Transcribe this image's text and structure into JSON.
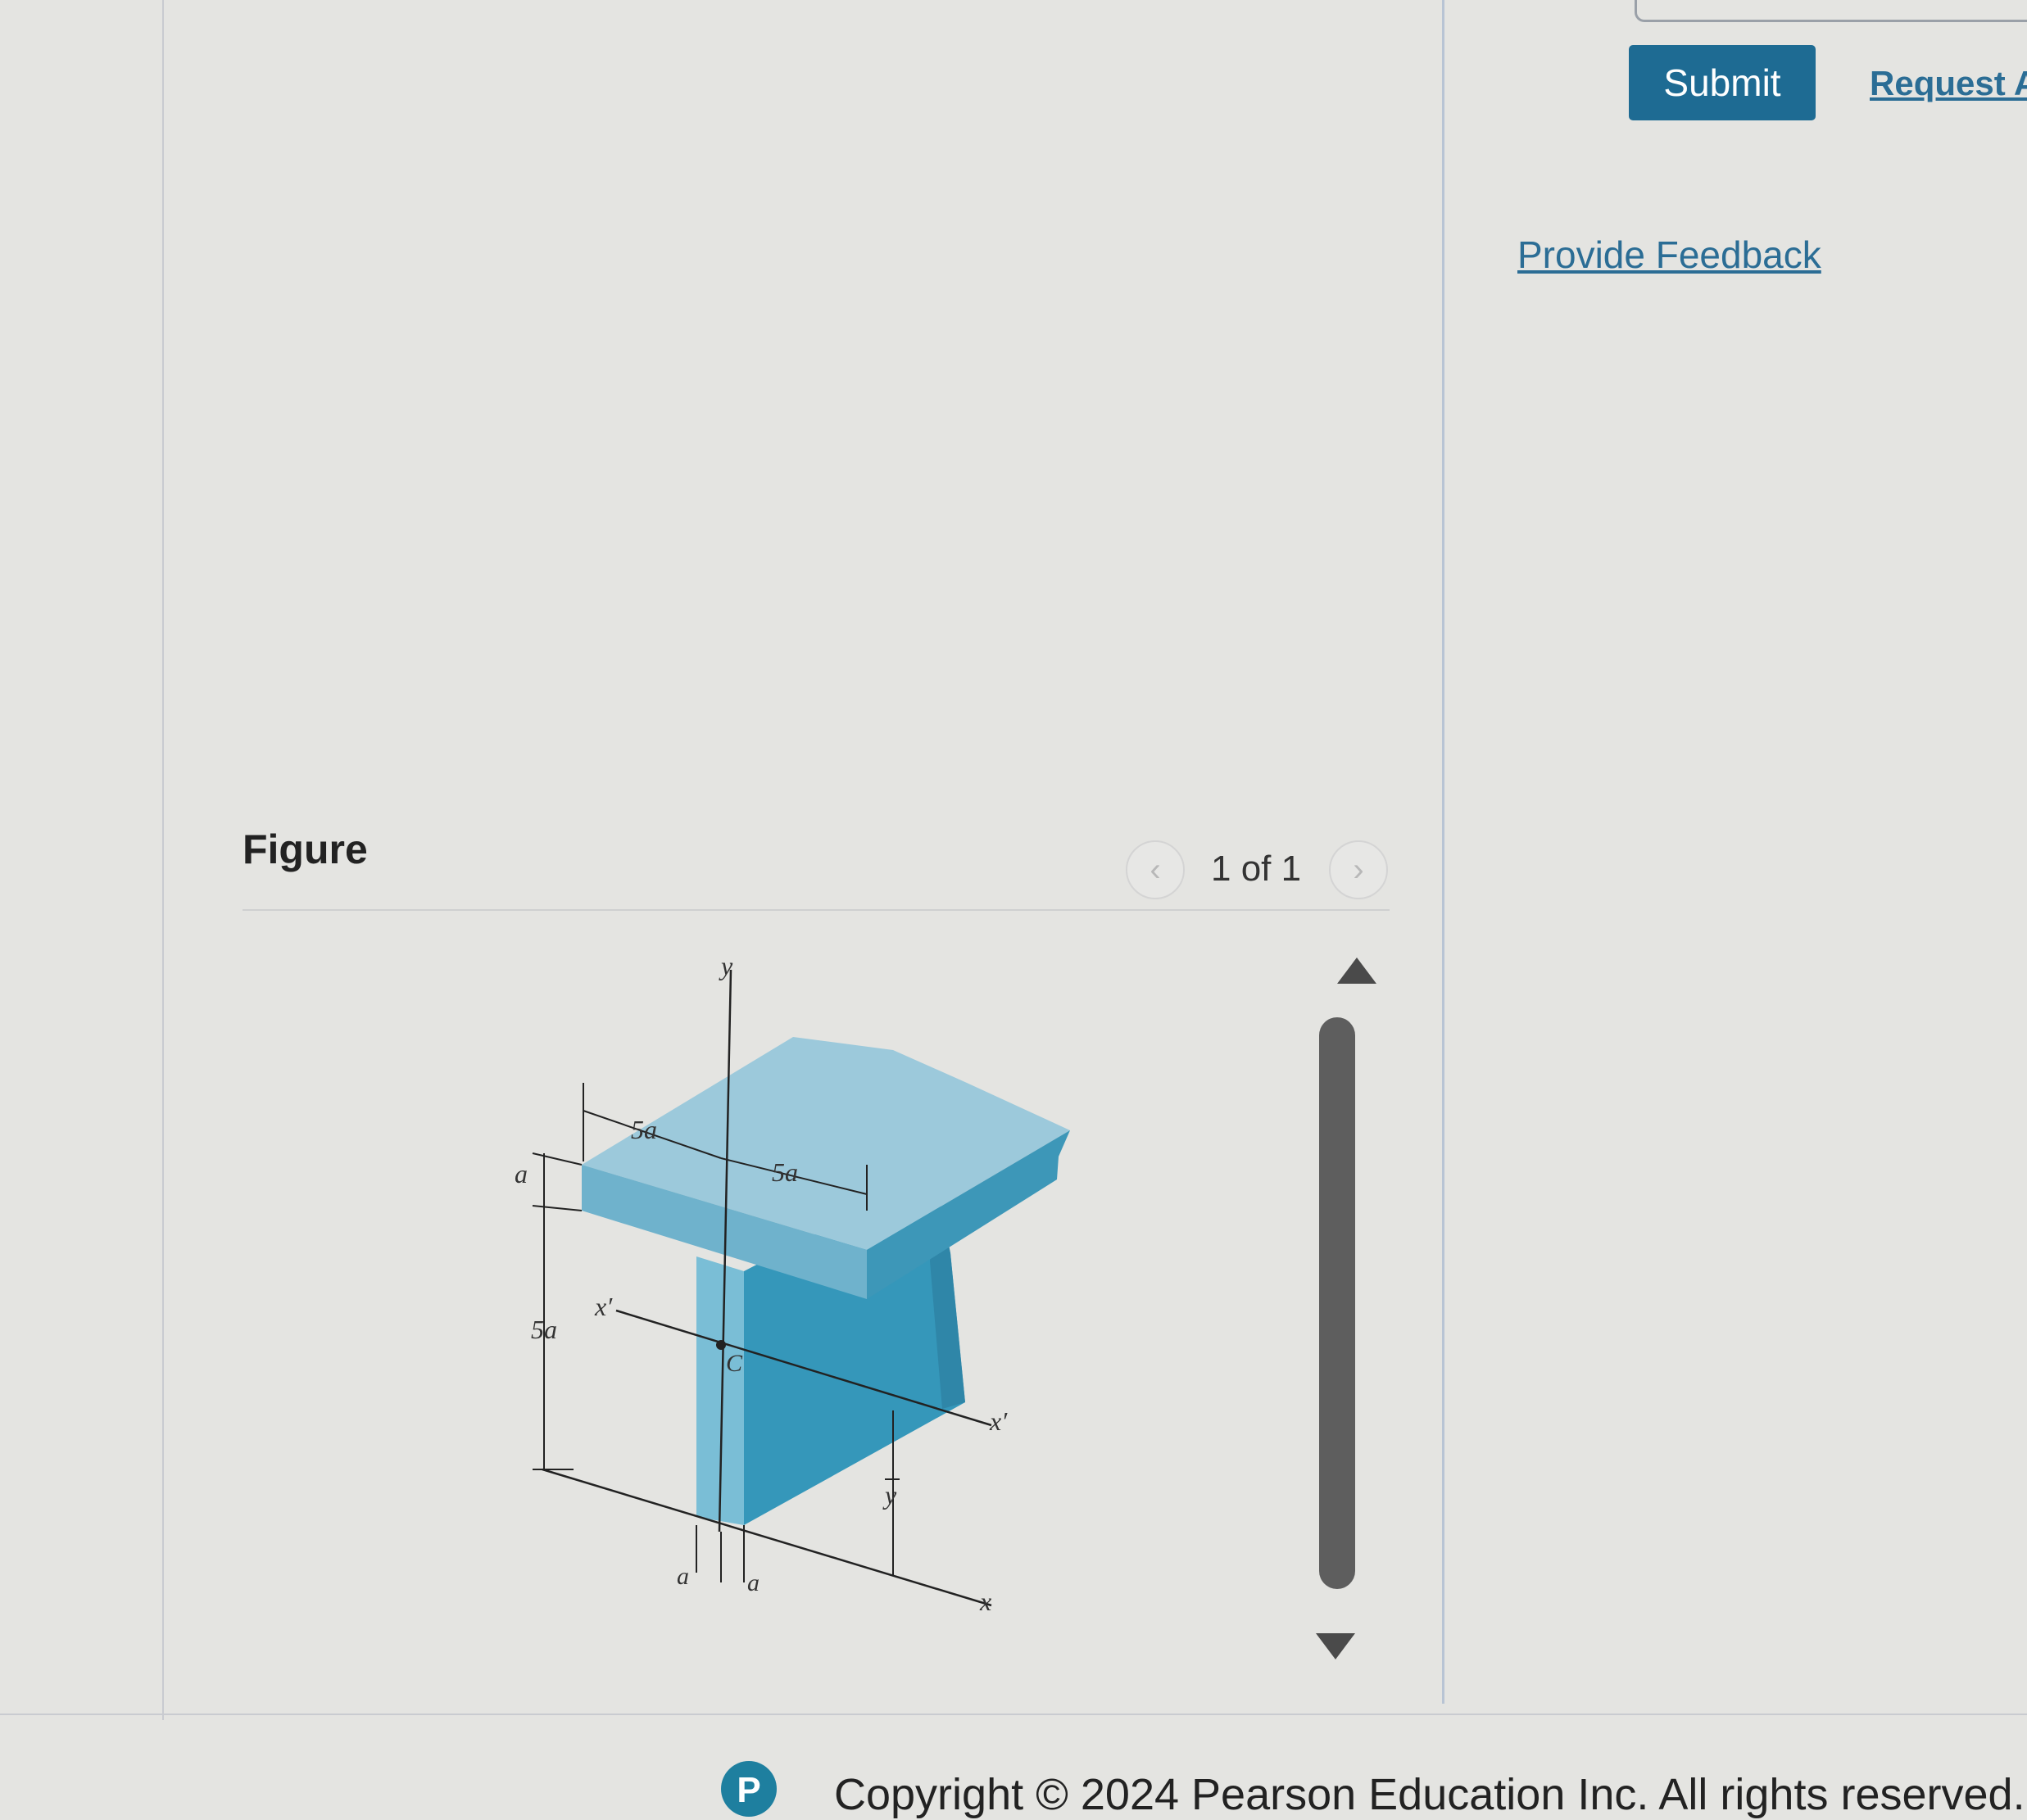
{
  "toolbar": {
    "submit_label": "Submit",
    "request_answer_label": "Request A"
  },
  "feedback": {
    "link_label": "Provide Feedback"
  },
  "figure": {
    "heading": "Figure",
    "pager": {
      "prev_icon": "chevron-left-icon",
      "next_icon": "chevron-right-icon",
      "indicator": "1 of 1"
    },
    "labels": {
      "y_axis": "y",
      "x_axis": "x",
      "x_prime_left": "x′",
      "x_prime_right": "x′",
      "centroid": "C",
      "y_bar": "y",
      "flange_thickness": "a",
      "web_height": "5a",
      "flange_overhang": "5a",
      "flange_width": "5a",
      "web_thickness_left": "a",
      "web_thickness_right": "a"
    },
    "colors": {
      "flange_top": "#9cc9db",
      "flange_front": "#6fb2cc",
      "flange_side": "#3d97b8",
      "web_front": "#7abed6",
      "web_side": "#3597ba",
      "web_shadow": "#2f86a8"
    }
  },
  "scrollbar": {
    "up_icon": "triangle-up-icon",
    "down_icon": "triangle-down-icon"
  },
  "footer": {
    "logo_letter": "P",
    "copyright": "Copyright © 2024 Pearson Education Inc. All rights reserved."
  }
}
